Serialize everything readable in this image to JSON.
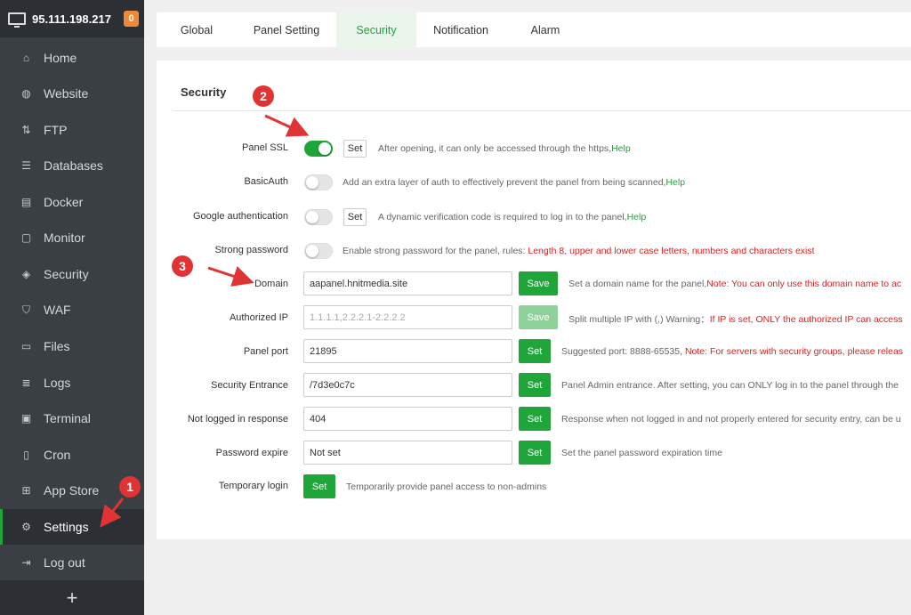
{
  "server": {
    "ip": "95.111.198.217",
    "badge": "0"
  },
  "nav": [
    {
      "label": "Home",
      "icon": "home-icon"
    },
    {
      "label": "Website",
      "icon": "globe-icon"
    },
    {
      "label": "FTP",
      "icon": "ftp-icon"
    },
    {
      "label": "Databases",
      "icon": "database-icon"
    },
    {
      "label": "Docker",
      "icon": "docker-icon"
    },
    {
      "label": "Monitor",
      "icon": "monitor-icon"
    },
    {
      "label": "Security",
      "icon": "shield-icon"
    },
    {
      "label": "WAF",
      "icon": "waf-icon"
    },
    {
      "label": "Files",
      "icon": "folder-icon"
    },
    {
      "label": "Logs",
      "icon": "logs-icon"
    },
    {
      "label": "Terminal",
      "icon": "terminal-icon"
    },
    {
      "label": "Cron",
      "icon": "cron-icon"
    },
    {
      "label": "App Store",
      "icon": "app-store-icon"
    },
    {
      "label": "Settings",
      "icon": "gear-icon"
    },
    {
      "label": "Log out",
      "icon": "logout-icon"
    }
  ],
  "nav_add": "+",
  "tabs": [
    "Global",
    "Panel Setting",
    "Security",
    "Notification",
    "Alarm"
  ],
  "section_title": "Security",
  "rows": {
    "panel_ssl": {
      "label": "Panel SSL",
      "btn": "Set",
      "desc": "After opening, it can only be accessed through the https,",
      "link": "Help"
    },
    "basic_auth": {
      "label": "BasicAuth",
      "desc": "Add an extra layer of auth to effectively prevent the panel from being scanned,",
      "link": "Help"
    },
    "google_auth": {
      "label": "Google authentication",
      "btn": "Set",
      "desc": "A dynamic verification code is required to log in to the panel,",
      "link": "Help"
    },
    "strong_pw": {
      "label": "Strong password",
      "desc": "Enable strong password for the panel, rules: ",
      "warn": "Length 8, upper and lower case letters, numbers and characters exist"
    },
    "domain": {
      "label": "Domain",
      "value": "aapanel.hnitmedia.site",
      "btn": "Save",
      "desc": "Set a domain name for the panel,",
      "warn": "Note: You can only use this domain name to ac"
    },
    "auth_ip": {
      "label": "Authorized IP",
      "placeholder": "1.1.1.1,2.2.2.1-2.2.2.2",
      "btn": "Save",
      "desc": "Split multiple IP with (,) Warning：",
      "warn": "If IP is set, ONLY the authorized IP can access"
    },
    "port": {
      "label": "Panel port",
      "value": "21895",
      "btn": "Set",
      "desc": "Suggested port: 8888-65535, ",
      "warn": "Note: For servers with security groups, please releas"
    },
    "entrance": {
      "label": "Security Entrance",
      "value": "/7d3e0c7c",
      "btn": "Set",
      "desc": "Panel Admin entrance. After setting, you can ONLY log in to the panel through the"
    },
    "not_logged": {
      "label": "Not logged in response",
      "value": "404",
      "btn": "Set",
      "desc": "Response when not logged in and not properly entered for security entry, can be u"
    },
    "pw_expire": {
      "label": "Password expire",
      "value": "Not set",
      "btn": "Set",
      "desc": "Set the panel password expiration time"
    },
    "temp_login": {
      "label": "Temporary login",
      "btn": "Set",
      "desc": "Temporarily provide panel access to non-admins"
    }
  },
  "markers": [
    "1",
    "2",
    "3"
  ],
  "colors": {
    "accent": "#20a53a",
    "warning": "#e02020",
    "marker": "#e03434",
    "sidebar": "#3a3f44"
  }
}
